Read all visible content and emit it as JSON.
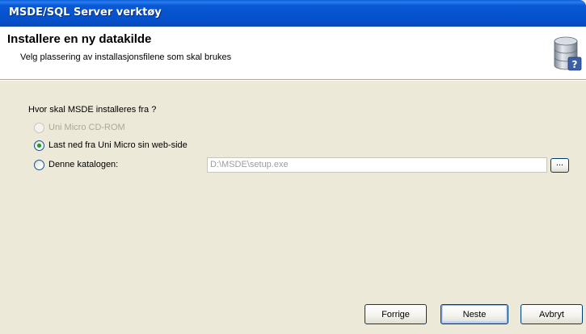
{
  "window": {
    "title": "MSDE/SQL Server verktøy"
  },
  "header": {
    "title": "Installere en ny datakilde",
    "subtitle": "Velg plassering av installasjonsfilene som skal brukes",
    "icon": "database-help-icon"
  },
  "source": {
    "question": "Hvor skal MSDE installeres fra ?",
    "options": [
      {
        "label": "Uni Micro CD-ROM",
        "enabled": false,
        "checked": false
      },
      {
        "label": "Last ned fra Uni Micro sin web-side",
        "enabled": true,
        "checked": true
      },
      {
        "label": "Denne katalogen:",
        "enabled": true,
        "checked": false
      }
    ],
    "path_value": "D:\\MSDE\\setup.exe",
    "browse_label": "..."
  },
  "buttons": {
    "back": "Forrige",
    "next": "Neste",
    "cancel": "Avbryt"
  },
  "colors": {
    "titlebar": "#0653ce",
    "dialog_bg": "#ece9d8",
    "radio_dot": "#21a121",
    "button_border": "#003c74"
  }
}
